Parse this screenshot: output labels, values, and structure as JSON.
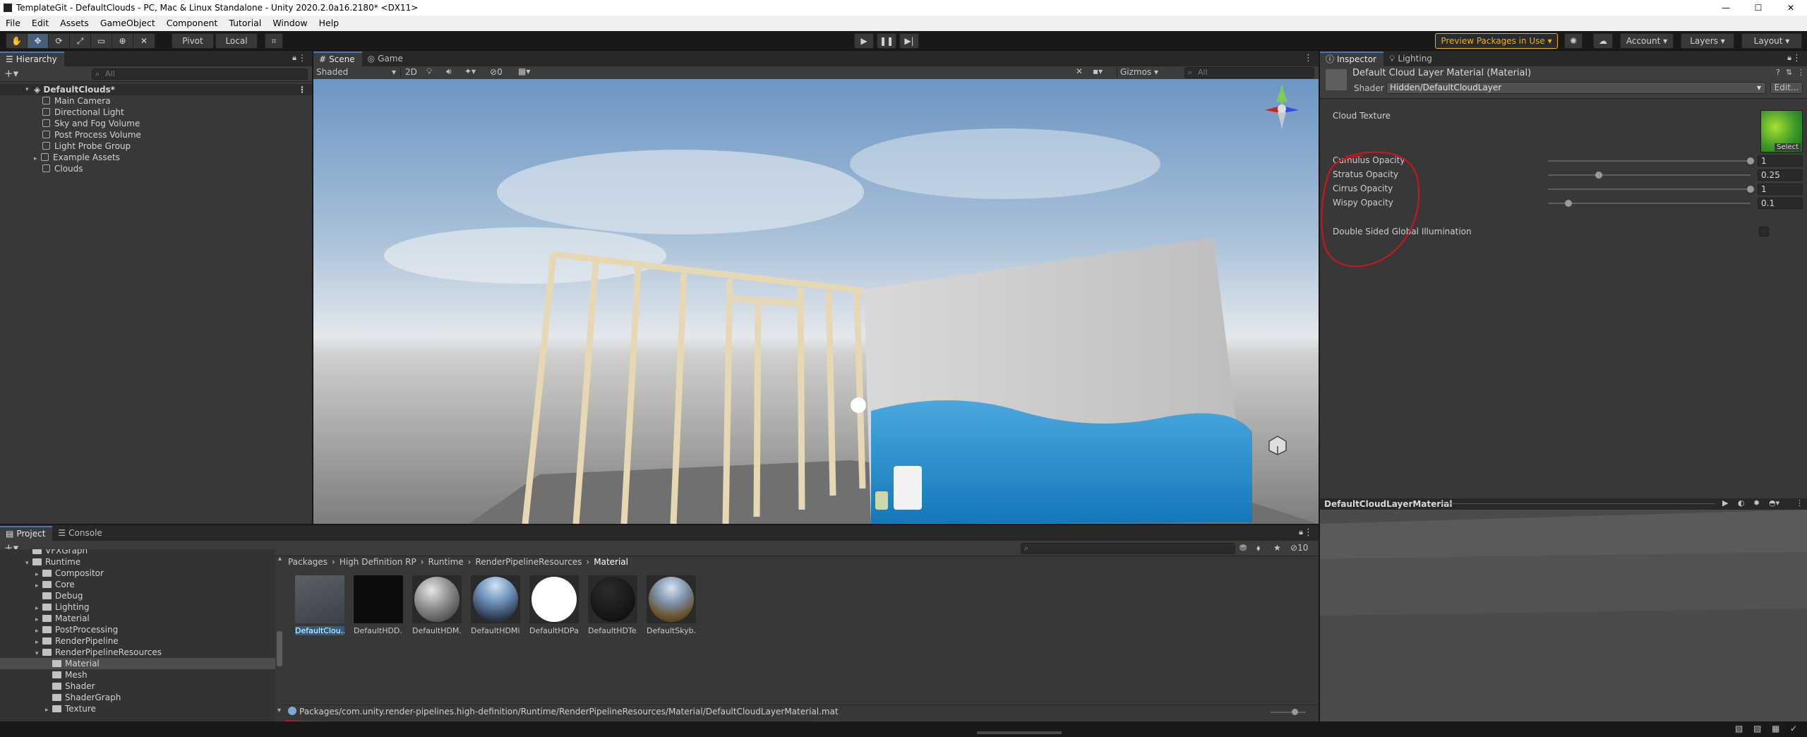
{
  "window": {
    "title": "TemplateGit - DefaultClouds - PC, Mac & Linux Standalone - Unity 2020.2.0a16.2180* <DX11>"
  },
  "menu": [
    "File",
    "Edit",
    "Assets",
    "GameObject",
    "Component",
    "Tutorial",
    "Window",
    "Help"
  ],
  "toolbar": {
    "pivot": "Pivot",
    "local": "Local",
    "preview_packages": "Preview Packages in Use",
    "account": "Account",
    "layers": "Layers",
    "layout": "Layout"
  },
  "hierarchy": {
    "tab": "Hierarchy",
    "search_placeholder": "All",
    "scene": "DefaultClouds*",
    "items": [
      "Main Camera",
      "Directional Light",
      "Sky and Fog Volume",
      "Post Process Volume",
      "Light Probe Group",
      "Example Assets",
      "Clouds"
    ]
  },
  "scene": {
    "tabs": [
      "Scene",
      "Game"
    ],
    "shading": "Shaded",
    "mode_2d": "2D",
    "hidden_count": "0",
    "gizmos": "Gizmos",
    "search_placeholder": "All"
  },
  "inspector": {
    "tabs": [
      "Inspector",
      "Lighting"
    ],
    "material_title": "Default Cloud Layer Material (Material)",
    "shader_label": "Shader",
    "shader_value": "Hidden/DefaultCloudLayer",
    "edit_button": "Edit...",
    "cloud_texture_label": "Cloud Texture",
    "select_label": "Select",
    "properties": [
      {
        "label": "Cumulus Opacity",
        "value": "1",
        "fraction": 1.0
      },
      {
        "label": "Stratus Opacity",
        "value": "0.25",
        "fraction": 0.25
      },
      {
        "label": "Cirrus Opacity",
        "value": "1",
        "fraction": 1.0
      },
      {
        "label": "Wispy Opacity",
        "value": "0.1",
        "fraction": 0.1
      }
    ],
    "double_sided_label": "Double Sided Global Illumination",
    "preview_title": "DefaultCloudLayerMaterial"
  },
  "project": {
    "tabs": [
      "Project",
      "Console"
    ],
    "hidden_count": "10",
    "tree": [
      {
        "label": "VFXGraph",
        "depth": 1,
        "arrow": ""
      },
      {
        "label": "Runtime",
        "depth": 1,
        "arrow": "▾"
      },
      {
        "label": "Compositor",
        "depth": 2,
        "arrow": "▸"
      },
      {
        "label": "Core",
        "depth": 2,
        "arrow": "▸"
      },
      {
        "label": "Debug",
        "depth": 2,
        "arrow": ""
      },
      {
        "label": "Lighting",
        "depth": 2,
        "arrow": "▸"
      },
      {
        "label": "Material",
        "depth": 2,
        "arrow": "▸"
      },
      {
        "label": "PostProcessing",
        "depth": 2,
        "arrow": "▸"
      },
      {
        "label": "RenderPipeline",
        "depth": 2,
        "arrow": "▸"
      },
      {
        "label": "RenderPipelineResources",
        "depth": 2,
        "arrow": "▾"
      },
      {
        "label": "Material",
        "depth": 3,
        "arrow": ""
      },
      {
        "label": "Mesh",
        "depth": 3,
        "arrow": ""
      },
      {
        "label": "Shader",
        "depth": 3,
        "arrow": ""
      },
      {
        "label": "ShaderGraph",
        "depth": 3,
        "arrow": ""
      },
      {
        "label": "Texture",
        "depth": 3,
        "arrow": "▸"
      }
    ],
    "breadcrumb": [
      "Packages",
      "High Definition RP",
      "Runtime",
      "RenderPipelineResources",
      "Material"
    ],
    "assets": [
      "DefaultClou...",
      "DefaultHDD...",
      "DefaultHDM...",
      "DefaultHDMi...",
      "DefaultHDPa...",
      "DefaultHDTe...",
      "DefaultSkyb..."
    ],
    "path": "Packages/com.unity.render-pipelines.high-definition/Runtime/RenderPipelineResources/Material/DefaultCloudLayerMaterial.mat"
  },
  "colors": {
    "accent": "#3a79bb",
    "annotation": "#d0141e",
    "preview_packages": "#f0b400"
  }
}
